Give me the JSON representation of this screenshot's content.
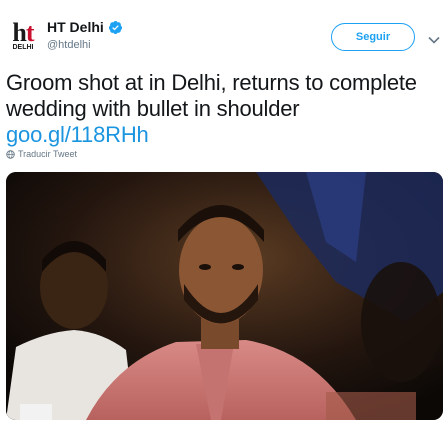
{
  "header": {
    "avatar_logo": "ht",
    "avatar_sub": "DELHI",
    "display_name": "HT Delhi",
    "handle": "@htdelhi",
    "follow_label": "Seguir"
  },
  "tweet": {
    "text": "Groom shot at in Delhi, returns to complete wedding with bullet in shoulder",
    "link": "goo.gl/118RHh",
    "translate_label": "Traducir Tweet"
  },
  "colors": {
    "accent": "#1da1f2",
    "link": "#1b95e0",
    "muted": "#657786",
    "brand_red": "#c8102e"
  },
  "icons": [
    "verified-badge-icon",
    "chevron-down-icon",
    "globe-icon"
  ]
}
